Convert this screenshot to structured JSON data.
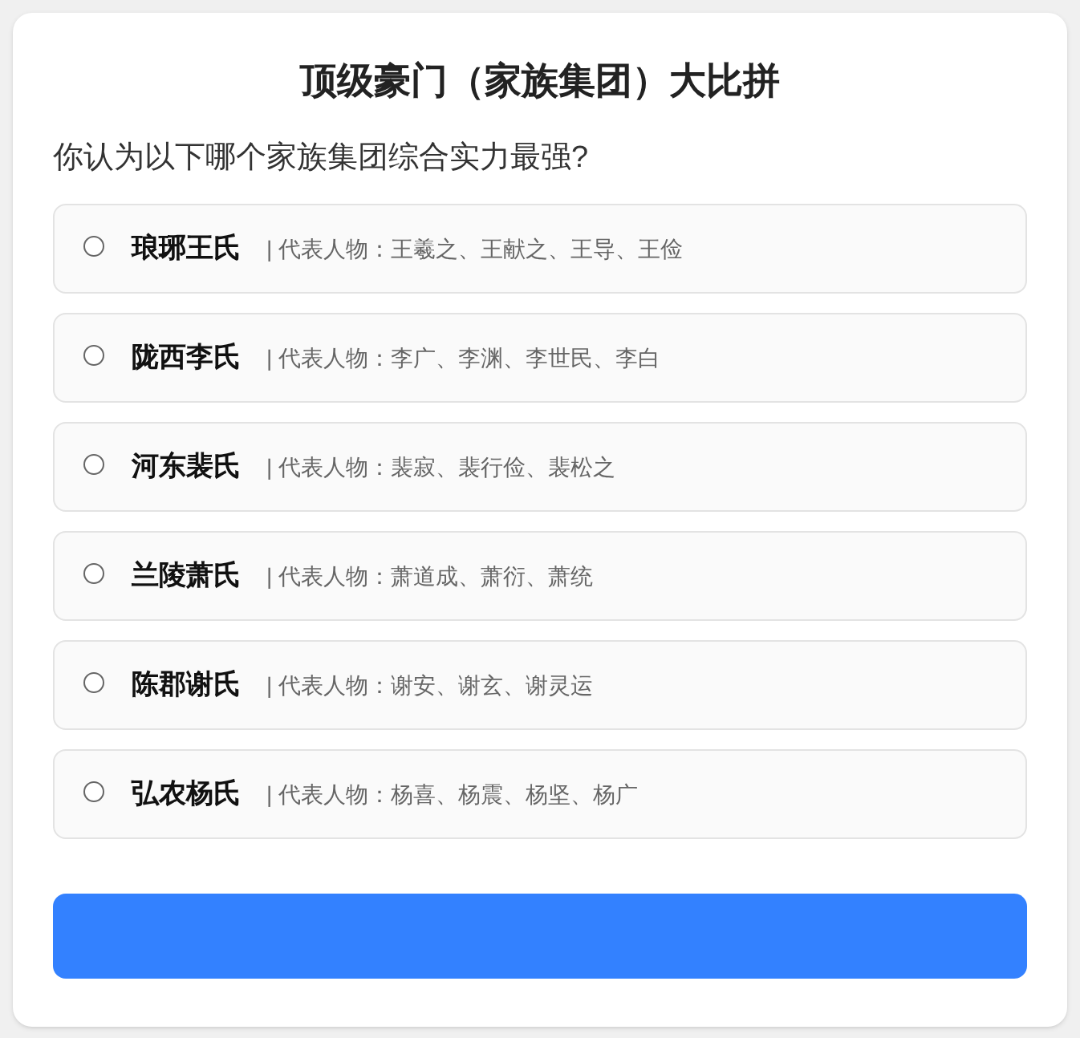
{
  "title": "顶级豪门（家族集团）大比拼",
  "question": "你认为以下哪个家族集团综合实力最强?",
  "options": [
    {
      "name": "琅琊王氏",
      "detail": "| 代表人物：王羲之、王献之、王导、王俭",
      "selected": false
    },
    {
      "name": "陇西李氏",
      "detail": "| 代表人物：李广、李渊、李世民、李白",
      "selected": false
    },
    {
      "name": "河东裴氏",
      "detail": "| 代表人物：裴寂、裴行俭、裴松之",
      "selected": false
    },
    {
      "name": "兰陵萧氏",
      "detail": "| 代表人物：萧道成、萧衍、萧统",
      "selected": false
    },
    {
      "name": "陈郡谢氏",
      "detail": "| 代表人物：谢安、谢玄、谢灵运",
      "selected": false
    },
    {
      "name": "弘农杨氏",
      "detail": "| 代表人物：杨喜、杨震、杨坚、杨广",
      "selected": false
    }
  ]
}
